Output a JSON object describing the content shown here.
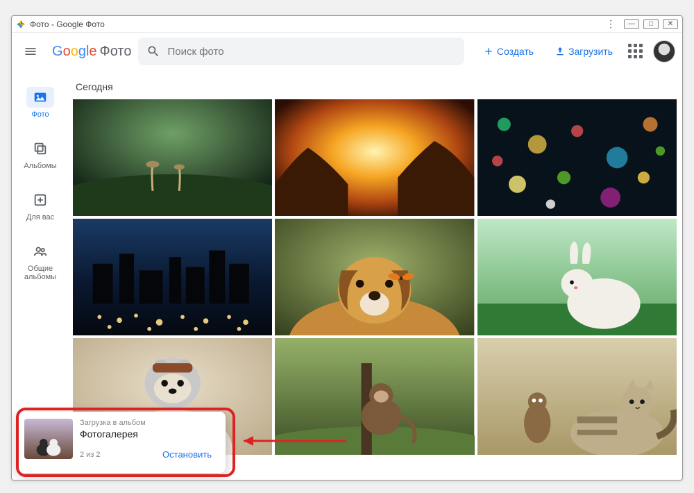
{
  "window": {
    "title": "Фото - Google Фото"
  },
  "header": {
    "product": "Фото",
    "search_placeholder": "Поиск фото",
    "create_label": "Создать",
    "upload_label": "Загрузить"
  },
  "nav": {
    "items": [
      {
        "id": "photos",
        "label": "Фото",
        "icon": "image-icon",
        "active": true
      },
      {
        "id": "albums",
        "label": "Альбомы",
        "icon": "albums-icon",
        "active": false
      },
      {
        "id": "foryou",
        "label": "Для вас",
        "icon": "plus-box-icon",
        "active": false
      },
      {
        "id": "sharing",
        "label": "Общие альбомы",
        "icon": "people-icon",
        "active": false
      }
    ]
  },
  "content": {
    "section_title": "Сегодня"
  },
  "toast": {
    "caption": "Загрузка в альбом",
    "title": "Фотогалерея",
    "count": "2 из 2",
    "action": "Остановить"
  }
}
